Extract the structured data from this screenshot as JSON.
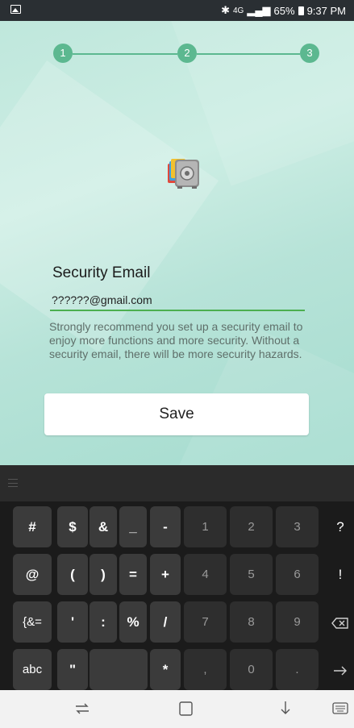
{
  "status_bar": {
    "network": "4G",
    "battery": "65%",
    "time": "9:37 PM"
  },
  "setup": {
    "steps": [
      "1",
      "2",
      "3"
    ],
    "title": "Security Email",
    "email_value": "??????@gmail.com",
    "description": "Strongly recommend you set up a security email to enjoy more functions and more security. Without a security email, there will be more security hazards.",
    "save_label": "Save"
  },
  "keyboard": {
    "rows": [
      [
        "#",
        "$",
        "&",
        "_",
        "-",
        "1",
        "2",
        "3",
        "?"
      ],
      [
        "@",
        "(",
        ")",
        "=",
        "+",
        "4",
        "5",
        "6",
        "!"
      ],
      [
        "{&=",
        "'",
        ":",
        "%",
        "/",
        "7",
        "8",
        "9",
        "backspace-icon"
      ],
      [
        "abc",
        "\"",
        "space",
        "*",
        ",",
        "0",
        ".",
        "enter-arrow-icon"
      ]
    ]
  },
  "colors": {
    "accent": "#5cb890",
    "underline": "#4caf50",
    "keyboard_bg": "#1b1b1b"
  }
}
